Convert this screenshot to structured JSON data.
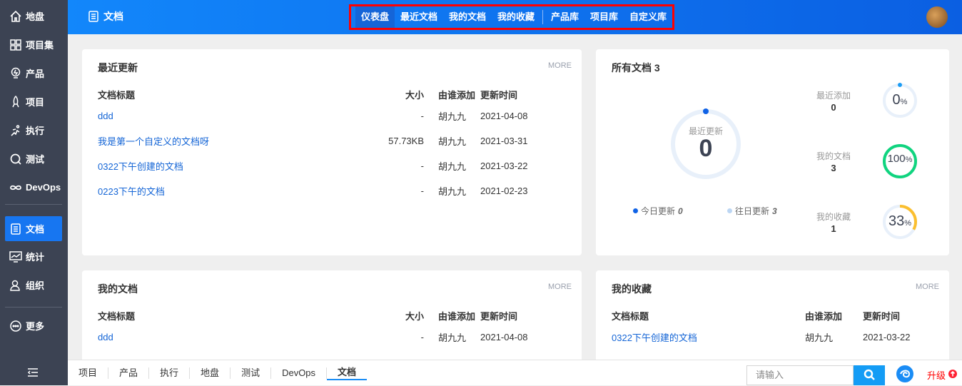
{
  "sidebar": {
    "items": [
      {
        "label": "地盘",
        "icon": "home-icon"
      },
      {
        "label": "项目集",
        "icon": "grid-icon"
      },
      {
        "label": "产品",
        "icon": "bulb-icon"
      },
      {
        "label": "项目",
        "icon": "rocket-icon"
      },
      {
        "label": "执行",
        "icon": "run-icon"
      },
      {
        "label": "测试",
        "icon": "test-icon"
      },
      {
        "label": "DevOps",
        "icon": "infinity-icon"
      },
      {
        "label": "文档",
        "icon": "doc-icon"
      },
      {
        "label": "统计",
        "icon": "chart-icon"
      },
      {
        "label": "组织",
        "icon": "user-icon"
      },
      {
        "label": "更多",
        "icon": "more-icon"
      }
    ]
  },
  "header": {
    "title": "文档",
    "nav": [
      "仪表盘",
      "最近文档",
      "我的文档",
      "我的收藏",
      "产品库",
      "项目库",
      "自定义库"
    ]
  },
  "recent": {
    "title": "最近更新",
    "more": "MORE",
    "columns": [
      "文档标题",
      "大小",
      "由谁添加",
      "更新时间"
    ],
    "rows": [
      [
        "ddd",
        "-",
        "胡九九",
        "2021-04-08"
      ],
      [
        "我是第一个自定义的文档呀",
        "57.73KB",
        "胡九九",
        "2021-03-31"
      ],
      [
        "0322下午创建的文档",
        "-",
        "胡九九",
        "2021-03-22"
      ],
      [
        "0223下午的文档",
        "-",
        "胡九九",
        "2021-02-23"
      ]
    ]
  },
  "all": {
    "title": "所有文档 3",
    "center_label": "最近更新",
    "center_value": "0",
    "today_label": "今日更新",
    "today_value": "0",
    "past_label": "往日更新",
    "past_value": "3",
    "stats": [
      {
        "label": "最近添加",
        "value": "0",
        "percent": 0,
        "pct_text": "0",
        "color": "#1a9cf5"
      },
      {
        "label": "我的文档",
        "value": "3",
        "percent": 100,
        "pct_text": "100",
        "color": "#10d47f"
      },
      {
        "label": "我的收藏",
        "value": "1",
        "percent": 33,
        "pct_text": "33",
        "color": "#fbbf2f"
      }
    ],
    "pct_sign": "%"
  },
  "mydocs": {
    "title": "我的文档",
    "more": "MORE",
    "columns": [
      "文档标题",
      "大小",
      "由谁添加",
      "更新时间"
    ],
    "rows": [
      [
        "ddd",
        "-",
        "胡九九",
        "2021-04-08"
      ]
    ]
  },
  "fav": {
    "title": "我的收藏",
    "more": "MORE",
    "columns": [
      "文档标题",
      "由谁添加",
      "更新时间"
    ],
    "rows": [
      [
        "0322下午创建的文档",
        "胡九九",
        "2021-03-22"
      ]
    ]
  },
  "bottom": {
    "tabs": [
      "项目",
      "产品",
      "执行",
      "地盘",
      "测试",
      "DevOps",
      "文档"
    ],
    "search_placeholder": "请输入",
    "upgrade": "升级"
  }
}
